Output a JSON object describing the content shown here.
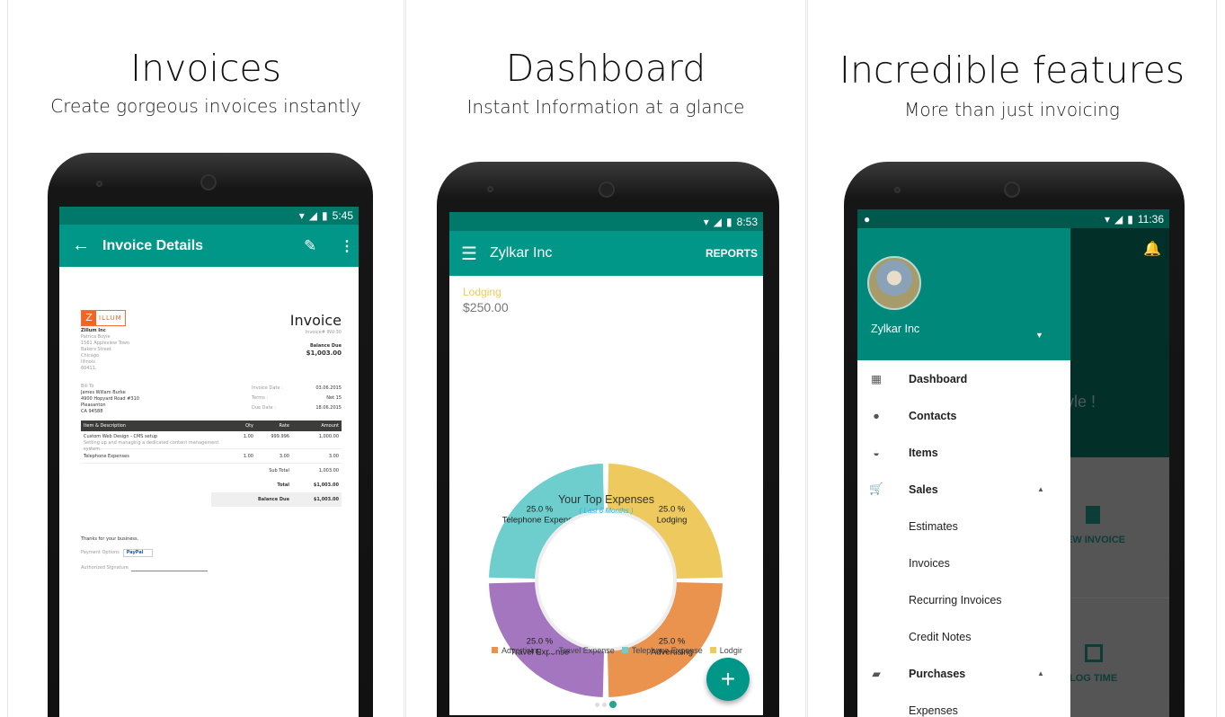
{
  "panels": [
    {
      "title": "Invoices",
      "subtitle": "Create gorgeous invoices instantly"
    },
    {
      "title": "Dashboard",
      "subtitle": "Instant Information at a glance"
    },
    {
      "title": "Incredible features",
      "subtitle": "More than just invoicing"
    }
  ],
  "colors": {
    "teal": "#00897B",
    "teal_dark": "#00695C",
    "accent_yellow": "#EDC95E"
  },
  "invoice_screen": {
    "time": "5:45",
    "toolbar_title": "Invoice Details",
    "icons": [
      "back-arrow-icon",
      "edit-pencil-icon",
      "more-vert-icon"
    ],
    "document": {
      "logo_letter": "Z",
      "logo_text": "ILLUM",
      "heading": "Invoice",
      "invoice_number": "Invoice# INV-30",
      "company": "Zillum Inc",
      "address": [
        "Patrica Boyle",
        "1561 Appleview Town",
        "Bakers Street",
        "Chicago",
        "Illinois",
        "60411,"
      ],
      "balance_due_label": "Balance Due",
      "balance_due": "$1,003.00",
      "bill_to_label": "Bill To",
      "bill_to": [
        "James Willam Burke",
        "4900 Hopyard Road #310",
        "Pleasanton",
        "CA 94588"
      ],
      "meta": [
        {
          "label": "Invoice Date :",
          "value": "03.06.2015"
        },
        {
          "label": "Terms :",
          "value": "Net 15"
        },
        {
          "label": "Due Date :",
          "value": "18.06.2015"
        }
      ],
      "columns": [
        "Item & Description",
        "Qty",
        "Rate",
        "Amount"
      ],
      "items": [
        {
          "name": "Custom Web Design - CMS setup",
          "desc": "Setting up and managing a dedicated content management system.",
          "qty": "1.00",
          "rate": "999.996",
          "amount": "1,000.00"
        },
        {
          "name": "Telephone Expenses",
          "desc": "",
          "qty": "1.00",
          "rate": "3.00",
          "amount": "3.00"
        }
      ],
      "sub_total_label": "Sub Total",
      "sub_total": "1,003.00",
      "total_label": "Total",
      "total": "$1,003.00",
      "balance_label": "Balance Due",
      "balance": "$1,003.00",
      "thanks": "Thanks for your business.",
      "payment_label": "Payment Options",
      "paypal": "PayPal",
      "signature_label": "Authorized Signature"
    }
  },
  "dashboard_screen": {
    "time": "8:53",
    "menu_icon": "hamburger-menu-icon",
    "toolbar_title": "Zylkar Inc",
    "reports_label": "REPORTS",
    "selected_label": "Lodging",
    "selected_value": "$250.00",
    "fab_icon": "plus-icon",
    "page_index": 3,
    "page_count": 3
  },
  "chart_data": {
    "type": "pie",
    "title": "Your Top Expenses",
    "subtitle": "( Last 6 Months )",
    "donut": true,
    "slices": [
      {
        "name": "Lodging",
        "value": 25.0,
        "label": "25.0 %",
        "color": "#EDC95E"
      },
      {
        "name": "Advertising",
        "value": 25.0,
        "label": "25.0 %",
        "color": "#E9934F"
      },
      {
        "name": "Travel Expense",
        "value": 25.0,
        "label": "25.0 %",
        "color": "#A576C0"
      },
      {
        "name": "Telephone Expense",
        "value": 25.0,
        "label": "25.0 %",
        "color": "#6ECDCD"
      }
    ],
    "legend": [
      "Advertising",
      "Travel Expense",
      "Telephone Expense",
      "Lodgir"
    ],
    "legend_colors": [
      "#E9934F",
      "#A576C0",
      "#6ECDCD",
      "#EDC95E"
    ],
    "legend_placement": "bottom"
  },
  "features_screen": {
    "time": "11:36",
    "org_name": "Zylkar Inc",
    "behind": {
      "greeting": "yle !",
      "new_invoice": "EW INVOICE",
      "log_time": "LOG TIME"
    },
    "menu": [
      {
        "label": "Dashboard",
        "icon": "dashboard-icon",
        "bold": true
      },
      {
        "label": "Contacts",
        "icon": "person-icon",
        "bold": true
      },
      {
        "label": "Items",
        "icon": "basket-icon",
        "bold": true
      },
      {
        "label": "Sales",
        "icon": "cart-icon",
        "bold": true,
        "expanded": true
      },
      {
        "label": "Estimates"
      },
      {
        "label": "Invoices"
      },
      {
        "label": "Recurring Invoices"
      },
      {
        "label": "Credit Notes"
      },
      {
        "label": "Purchases",
        "icon": "shopping-bag-icon",
        "bold": true,
        "expanded": true
      },
      {
        "label": "Expenses"
      }
    ]
  }
}
